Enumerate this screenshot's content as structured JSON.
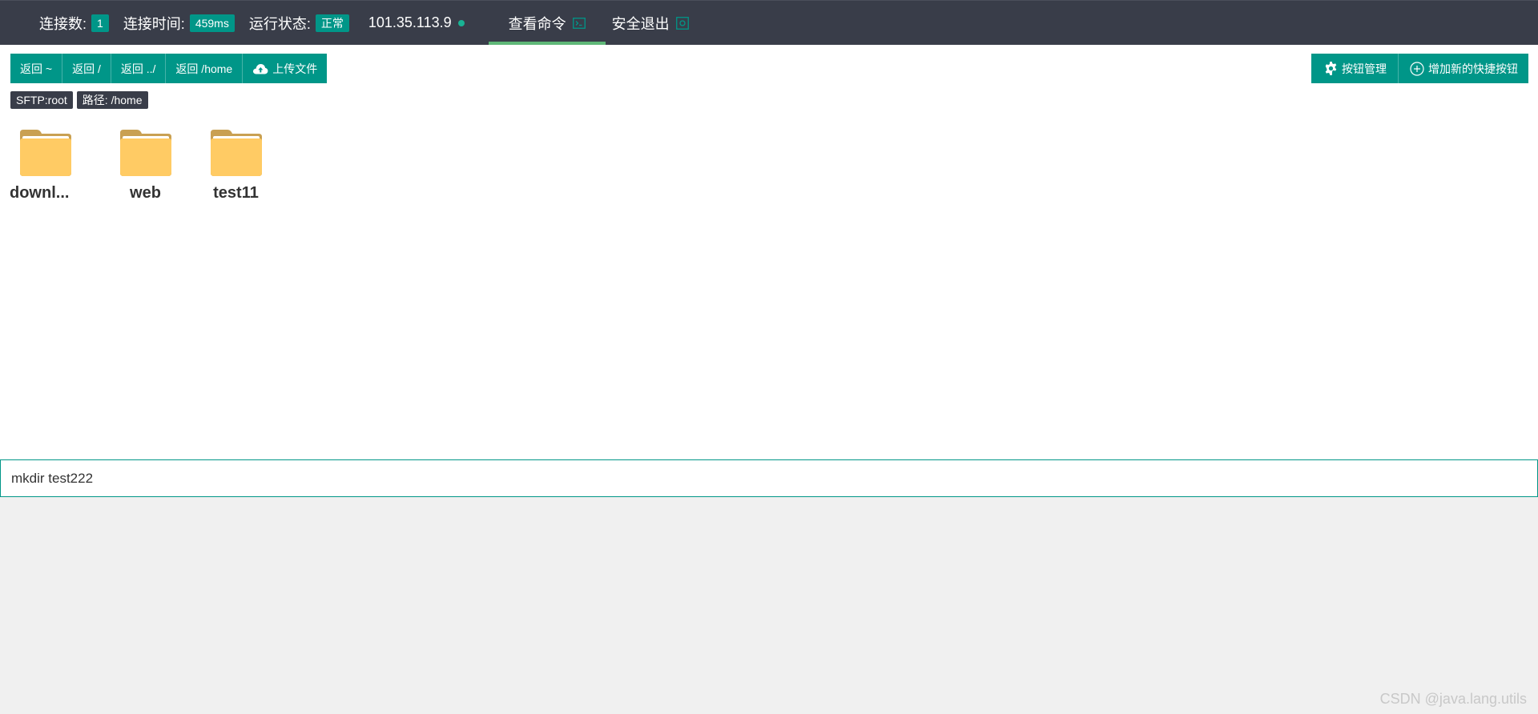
{
  "topbar": {
    "connections_label": "连接数:",
    "connections_value": "1",
    "connect_time_label": "连接时间:",
    "connect_time_value": "459ms",
    "status_label": "运行状态:",
    "status_value": "正常",
    "ip": "101.35.113.9",
    "tabs": [
      {
        "label": "查看命令",
        "icon": "terminal-icon"
      },
      {
        "label": "安全退出",
        "icon": "power-icon"
      }
    ]
  },
  "toolbar": {
    "left_buttons": [
      "返回 ~",
      "返回 /",
      "返回 ../",
      "返回 /home",
      "上传文件"
    ],
    "right_buttons": [
      "按钮管理",
      "增加新的快捷按钮"
    ]
  },
  "tags": {
    "sftp": "SFTP:root",
    "path": "路径: /home"
  },
  "files": [
    {
      "name": "downl...",
      "icon": "folder-icon"
    },
    {
      "name": "web",
      "icon": "folder-icon"
    },
    {
      "name": "test11",
      "icon": "folder-icon"
    }
  ],
  "command": {
    "value": "mkdir test222"
  },
  "watermark": "CSDN @java.lang.utils",
  "colors": {
    "topbar": "#393d49",
    "accent": "#009688",
    "tab_indicator": "#5fb878",
    "folder": "#ffcb64"
  }
}
